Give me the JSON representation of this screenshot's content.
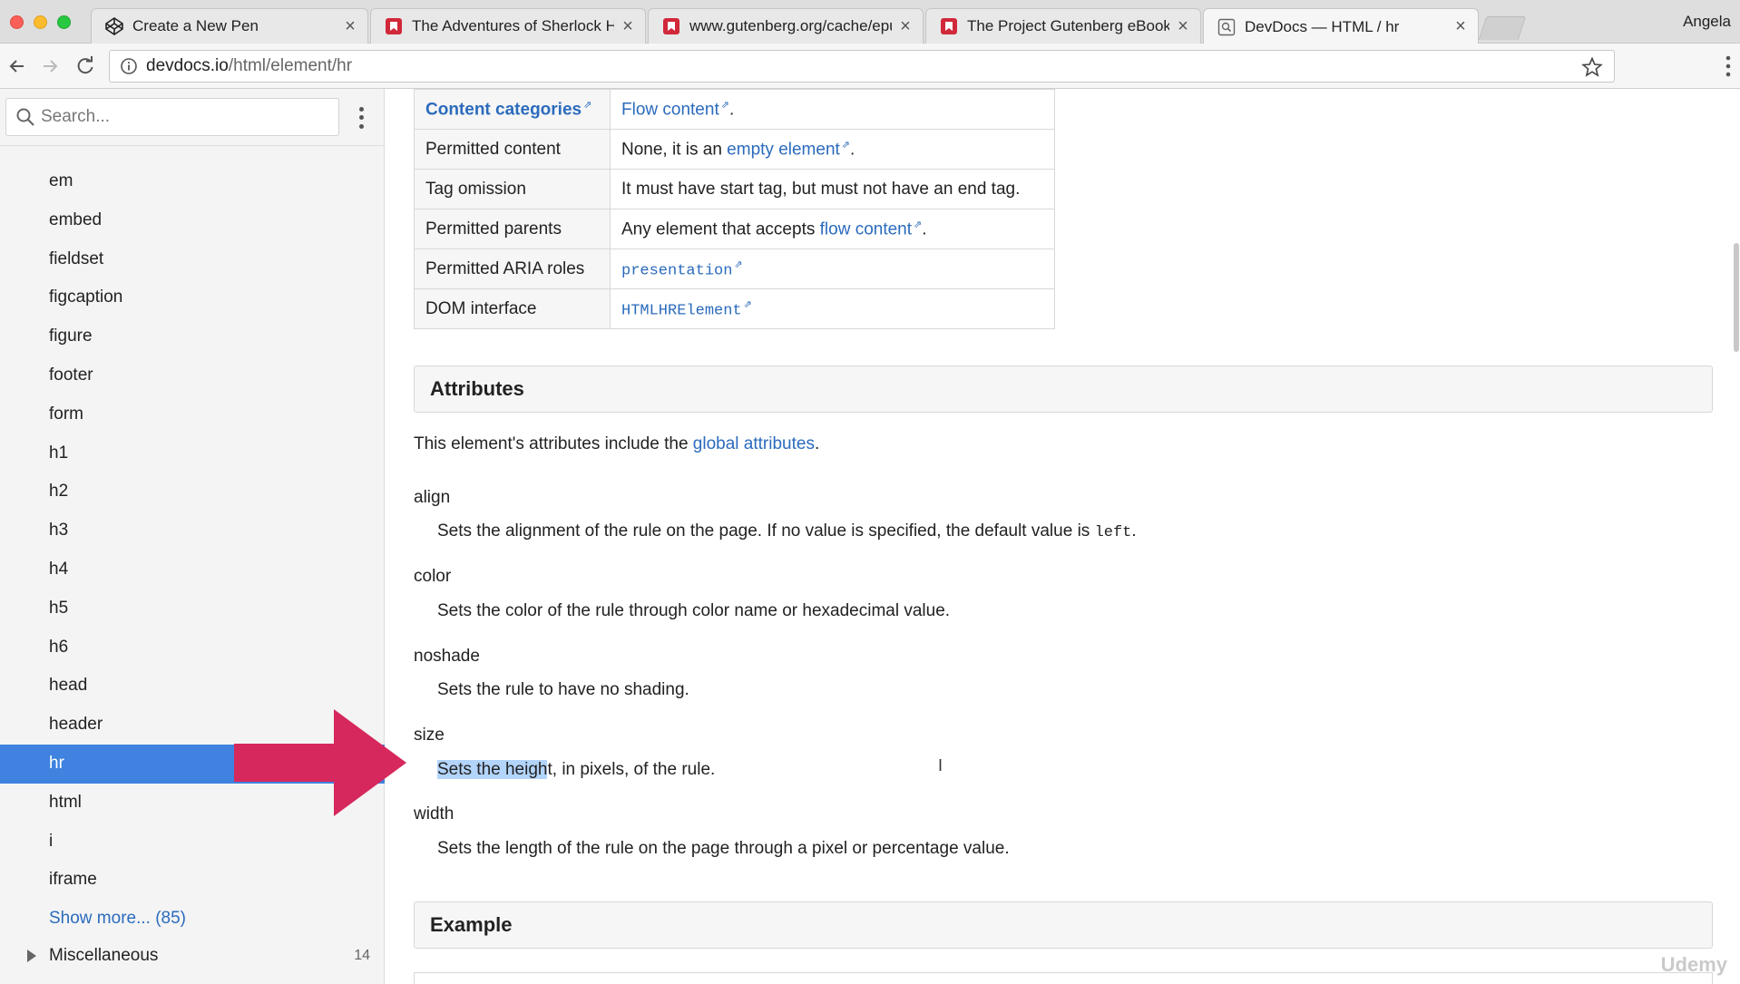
{
  "browser": {
    "profile_name": "Angela",
    "tabs": [
      {
        "title": "Create a New Pen",
        "icon": "codepen-icon"
      },
      {
        "title": "The Adventures of Sherlock Ho",
        "icon": "gutenberg-icon"
      },
      {
        "title": "www.gutenberg.org/cache/epu",
        "icon": "gutenberg-icon"
      },
      {
        "title": "The Project Gutenberg eBook o",
        "icon": "gutenberg-icon"
      },
      {
        "title": "DevDocs — HTML / hr",
        "icon": "devdocs-icon"
      }
    ],
    "url_host": "devdocs.io",
    "url_path": "/html/element/hr"
  },
  "sidebar": {
    "search_placeholder": "Search...",
    "items": [
      "em",
      "embed",
      "fieldset",
      "figcaption",
      "figure",
      "footer",
      "form",
      "h1",
      "h2",
      "h3",
      "h4",
      "h5",
      "h6",
      "head",
      "header",
      "hr",
      "html",
      "i",
      "iframe"
    ],
    "active_item": "hr",
    "show_more": "Show more... (85)",
    "misc_label": "Miscellaneous",
    "misc_count": "14"
  },
  "summary_table": {
    "content_categories_label": "Content categories",
    "content_categories_value": "Flow content",
    "permitted_content_label": "Permitted content",
    "permitted_content_prefix": "None, it is an ",
    "permitted_content_link": "empty element",
    "tag_omission_label": "Tag omission",
    "tag_omission_value": "It must have start tag, but must not have an end tag.",
    "permitted_parents_label": "Permitted parents",
    "permitted_parents_prefix": "Any element that accepts ",
    "permitted_parents_link": "flow content",
    "aria_label": "Permitted ARIA roles",
    "aria_value": "presentation",
    "dom_label": "DOM interface",
    "dom_value": "HTMLHRElement"
  },
  "attributes": {
    "heading": "Attributes",
    "intro_prefix": "This element's attributes include the ",
    "intro_link": "global attributes",
    "items": [
      {
        "name": "align",
        "desc": "Sets the alignment of the rule on the page. If no value is specified, the default value is ",
        "code": "left"
      },
      {
        "name": "color",
        "desc": "Sets the color of the rule through color name or hexadecimal value."
      },
      {
        "name": "noshade",
        "desc": "Sets the rule to have no shading."
      },
      {
        "name": "size",
        "desc_highlight": "Sets the heigh",
        "desc_rest": "t, in pixels, of the rule."
      },
      {
        "name": "width",
        "desc": "Sets the length of the rule on the page through a pixel or percentage value."
      }
    ]
  },
  "example": {
    "heading": "Example"
  },
  "watermark": "Udemy",
  "colors": {
    "link": "#2b6bbd",
    "active_sidebar": "#3f82e0",
    "arrow": "#d6285c",
    "highlight": "#b3d4fb"
  }
}
